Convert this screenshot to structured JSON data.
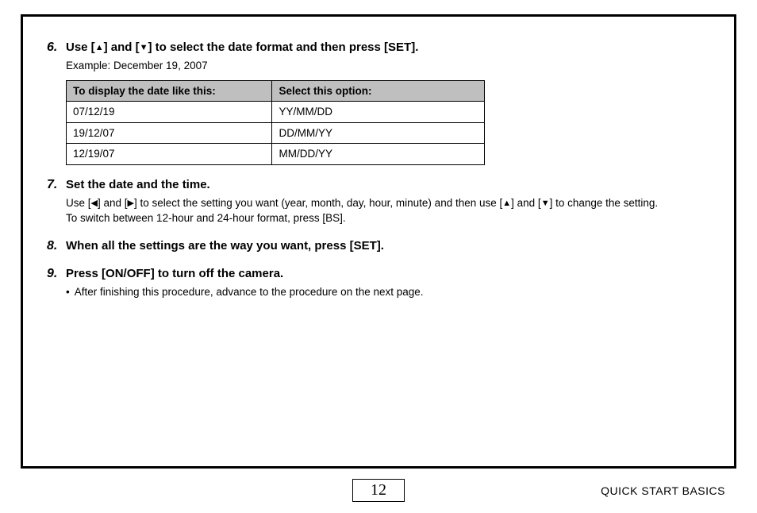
{
  "steps": {
    "s6": {
      "num": "6.",
      "title_parts": [
        "Use [",
        "] and [",
        "] to select the date format and then press [SET]."
      ],
      "example": "Example: December 19, 2007",
      "table": {
        "header": {
          "a": "To display the date like this:",
          "b": "Select this option:"
        },
        "rows": [
          {
            "a": "07/12/19",
            "b": "YY/MM/DD"
          },
          {
            "a": "19/12/07",
            "b": "DD/MM/YY"
          },
          {
            "a": "12/19/07",
            "b": "MM/DD/YY"
          }
        ]
      }
    },
    "s7": {
      "num": "7.",
      "title": "Set the date and the time.",
      "line1_parts": [
        "Use [",
        "] and [",
        "] to select the setting you want (year, month, day, hour, minute) and then use [",
        "] and [",
        "] to change the setting."
      ],
      "line2": "To switch between 12-hour and 24-hour format, press [BS]."
    },
    "s8": {
      "num": "8.",
      "title": "When all the settings are the way you want, press [SET]."
    },
    "s9": {
      "num": "9.",
      "title": "Press [ON/OFF] to turn off the camera.",
      "bullet": "After finishing this procedure, advance to the procedure on the next page."
    }
  },
  "footer": {
    "page": "12",
    "section": "QUICK START BASICS"
  },
  "glyphs": {
    "up": "▲",
    "down": "▼",
    "left": "◀",
    "right": "▶",
    "dot": "•"
  }
}
